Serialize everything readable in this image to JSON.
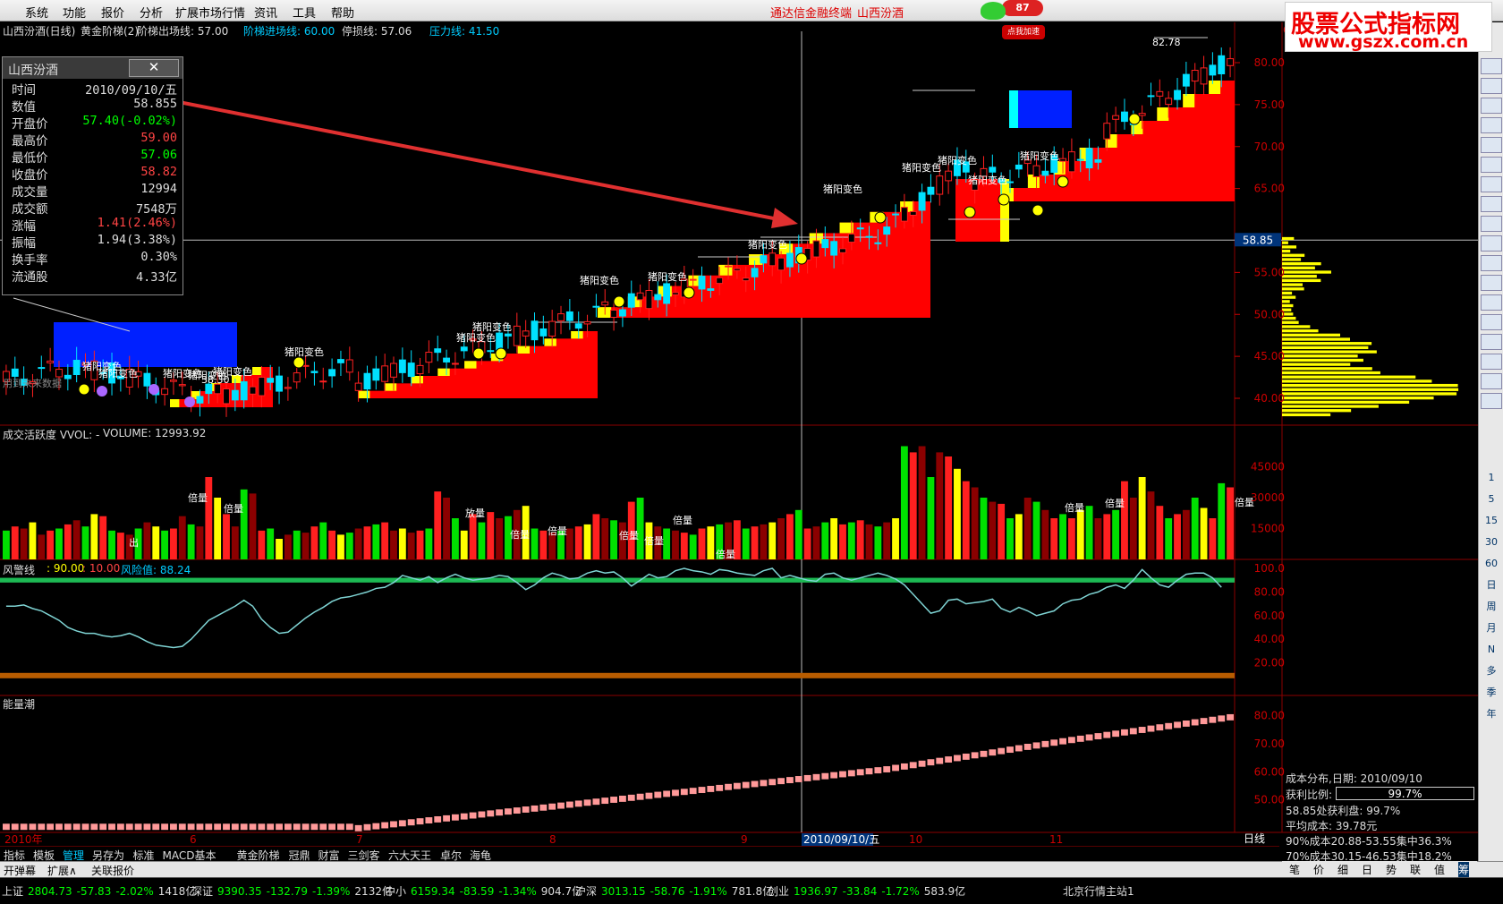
{
  "menu": {
    "items": [
      "系统",
      "功能",
      "报价",
      "分析",
      "扩展市场行情",
      "资讯",
      "工具",
      "帮助"
    ],
    "center_title": "通达信金融终端",
    "center_stock": "山西汾酒",
    "badge": "87",
    "badge_label": "点我加速"
  },
  "watermark": {
    "line1": "股票公式指标网",
    "line2": "www.gszx.com.cn"
  },
  "header": {
    "stock": "山西汾酒(日线)",
    "indicator": "黄金阶梯(2)",
    "exit_label": "阶梯出场线: 57.00",
    "entry_label": "阶梯进场线: 60.00",
    "stop_label": "停损线: 57.06",
    "pressure_label": "压力线: 41.50"
  },
  "info": {
    "title": "山西汾酒",
    "close_symbol": "✕",
    "rows": [
      {
        "k": "时间",
        "v": "2010/09/10/五",
        "c": "#ddd"
      },
      {
        "k": "数值",
        "v": "58.855",
        "c": "#ddd"
      },
      {
        "k": "开盘价",
        "v": "57.40(-0.02%)",
        "c": "#0f0"
      },
      {
        "k": "最高价",
        "v": "59.00",
        "c": "#f44"
      },
      {
        "k": "最低价",
        "v": "57.06",
        "c": "#0f0"
      },
      {
        "k": "收盘价",
        "v": "58.82",
        "c": "#f44"
      },
      {
        "k": "成交量",
        "v": "12994",
        "c": "#ddd"
      },
      {
        "k": "成交额",
        "v": "7548万",
        "c": "#ddd"
      },
      {
        "k": "涨幅",
        "v": "1.41(2.46%)",
        "c": "#f44"
      },
      {
        "k": "振幅",
        "v": "1.94(3.38%)",
        "c": "#ddd"
      },
      {
        "k": "换手率",
        "v": "0.30%",
        "c": "#ddd"
      },
      {
        "k": "流通股",
        "v": "4.33亿",
        "c": "#ddd"
      }
    ]
  },
  "main_axis": {
    "labels": [
      "80.00",
      "75.00",
      "70.00",
      "65.00",
      "55.00",
      "50.00",
      "45.00",
      "40.00"
    ],
    "values": [
      80,
      75,
      70,
      65,
      55,
      50,
      45,
      40
    ],
    "current": "58.85",
    "current_value": 58.85,
    "top_label": "600"
  },
  "main_annotations": {
    "hi": "82.78",
    "lo": "38.30",
    "future_note": "用到未来数据",
    "labels": [
      "猪阳变色",
      "猪阳变色",
      "猪阳变色",
      "猪阳变色",
      "猪阳变色",
      "猪阳变色",
      "猪阳变色",
      "猪阳变色",
      "猪阳变色",
      "猪阳变色",
      "猪阳变色",
      "猪阳变色",
      "猪阳变色",
      "猪阳变色",
      "猪阳变色",
      "猪阳变色"
    ]
  },
  "vol": {
    "title": "成交活跃度 VVOL: -",
    "volume_label": "VOLUME: 12993.92",
    "axis": [
      "45000",
      "30000",
      "15000"
    ],
    "axis_values": [
      45000,
      30000,
      15000
    ],
    "tags": [
      "倍量",
      "出",
      "倍量",
      "放量",
      "倍量",
      "倍量",
      "倍量",
      "倍量",
      "倍量",
      "倍量",
      "倍量",
      "倍量",
      "倍量"
    ],
    "series": [
      14000,
      16000,
      15000,
      18000,
      12000,
      14000,
      15000,
      17000,
      19000,
      16000,
      22000,
      21000,
      14000,
      13000,
      12000,
      15000,
      18000,
      16000,
      14000,
      15000,
      21000,
      17000,
      16000,
      40000,
      30000,
      22000,
      16000,
      34000,
      32000,
      14000,
      15000,
      10000,
      12000,
      14000,
      13000,
      16000,
      18000,
      14000,
      12000,
      13000,
      15000,
      16000,
      17000,
      18000,
      14000,
      15000,
      13000,
      14000,
      15000,
      33000,
      30000,
      20000,
      14000,
      22000,
      18000,
      23000,
      20000,
      21000,
      24000,
      26000,
      15000,
      14000,
      13000,
      14000,
      15000,
      16000,
      17000,
      22000,
      20000,
      19000,
      18000,
      28000,
      30000,
      18000,
      16000,
      15000,
      14000,
      13000,
      12000,
      15000,
      16000,
      17000,
      18000,
      19000,
      15000,
      16000,
      17000,
      18000,
      20000,
      22000,
      24000,
      15000,
      16000,
      18000,
      20000,
      17000,
      18000,
      19000,
      17000,
      16000,
      18000,
      20000,
      55000,
      52000,
      55000,
      40000,
      52000,
      50000,
      44000,
      38000,
      35000,
      30000,
      28000,
      27000,
      20000,
      22000,
      30000,
      28000,
      24000,
      20000,
      22000,
      20000,
      24000,
      26000,
      20000,
      22000,
      24000,
      38000,
      30000,
      40000,
      33000,
      26000,
      20000,
      22000,
      24000,
      30000,
      25000,
      20000,
      37000,
      35000
    ]
  },
  "risk": {
    "title": "风警线",
    "v1": ": 90.00",
    "v2": ": 10.00",
    "risk_label": "风险值: 88.24",
    "axis": [
      "100.0",
      "80.00",
      "60.00",
      "40.00",
      "20.00"
    ],
    "axis_values": [
      100,
      80,
      60,
      40,
      20
    ],
    "series": [
      68,
      68,
      69,
      66,
      64,
      60,
      56,
      50,
      47,
      45,
      45,
      43,
      42,
      43,
      45,
      42,
      38,
      35,
      34,
      33,
      34,
      40,
      48,
      56,
      60,
      64,
      68,
      73,
      68,
      57,
      50,
      45,
      46,
      52,
      58,
      63,
      67,
      72,
      75,
      76,
      78,
      80,
      83,
      84,
      88,
      94,
      92,
      90,
      93,
      88,
      92,
      95,
      92,
      90,
      91,
      92,
      94,
      93,
      88,
      82,
      86,
      92,
      96,
      94,
      91,
      92,
      96,
      98,
      96,
      97,
      92,
      85,
      90,
      95,
      92,
      93,
      98,
      100,
      98,
      97,
      95,
      99,
      98,
      96,
      95,
      94,
      98,
      100,
      92,
      94,
      92,
      90,
      89,
      95,
      96,
      92,
      90,
      92,
      94,
      96,
      94,
      91,
      86,
      78,
      70,
      62,
      64,
      73,
      74,
      70,
      71,
      72,
      74,
      66,
      63,
      67,
      64,
      60,
      62,
      64,
      70,
      73,
      74,
      78,
      80,
      84,
      86,
      83,
      90,
      99,
      92,
      86,
      84,
      90,
      95,
      96,
      96,
      92,
      84
    ]
  },
  "energy": {
    "title": "能量潮",
    "axis": [
      "80.00",
      "70.00",
      "60.00",
      "50.00"
    ],
    "axis_values": [
      80,
      70,
      60,
      50
    ]
  },
  "xaxis": {
    "labels": [
      "2010年",
      "6",
      "7",
      "8",
      "9",
      "2010/09/10/五",
      "10",
      "11"
    ],
    "right_label": "日线",
    "cursor_date": "2010/09/10/五"
  },
  "cost": {
    "title": "成本分布,日期: 2010/09/10",
    "ratio_label": "获利比例:",
    "ratio_value": "99.7%",
    "l3": "58.85处获利盘: 99.7%",
    "l4": "平均成本: 39.78元",
    "l5": "90%成本20.88-53.55集中36.3%",
    "l6": "70%成本30.15-46.53集中18.2%"
  },
  "bottom_tabs": [
    "指标",
    "模板",
    "管理",
    "另存为",
    "标准",
    "MACD基本",
    "黄金阶梯",
    "冠鼎",
    "财富",
    "三剑客",
    "六大天王",
    "卓尔",
    "海龟"
  ],
  "tabbar2": [
    "开弹幕",
    "扩展∧",
    "关联报价"
  ],
  "right_panel_btns": [
    "笔",
    "价",
    "细",
    "日",
    "势",
    "联",
    "值",
    "筹"
  ],
  "right_toolbar": [
    "1",
    "5",
    "15",
    "30",
    "60",
    "日",
    "周",
    "月",
    "N",
    "多",
    "季",
    "年"
  ],
  "status": [
    {
      "name": "上证",
      "v": "2804.73",
      "ch": "-57.83",
      "pct": "-2.02%",
      "amt": "1418亿"
    },
    {
      "name": "深证",
      "v": "9390.35",
      "ch": "-132.79",
      "pct": "-1.39%",
      "amt": "2132亿"
    },
    {
      "name": "中小",
      "v": "6159.34",
      "ch": "-83.59",
      "pct": "-1.34%",
      "amt": "904.7亿"
    },
    {
      "name": "沪深",
      "v": "3013.15",
      "ch": "-58.76",
      "pct": "-1.91%",
      "amt": "781.8亿"
    },
    {
      "name": "创业",
      "v": "1936.97",
      "ch": "-33.84",
      "pct": "-1.72%",
      "amt": "583.9亿"
    }
  ],
  "server": "北京行情主站1",
  "colors": {
    "up": "#ff2020",
    "down": "#00e0ff",
    "step_red": "#ff0000",
    "step_yellow": "#ffff00",
    "blue_box": "#0020ff",
    "risk_line": "#7fd4d4",
    "cost_fill": "#ffff00",
    "energy": "#ff9999"
  }
}
